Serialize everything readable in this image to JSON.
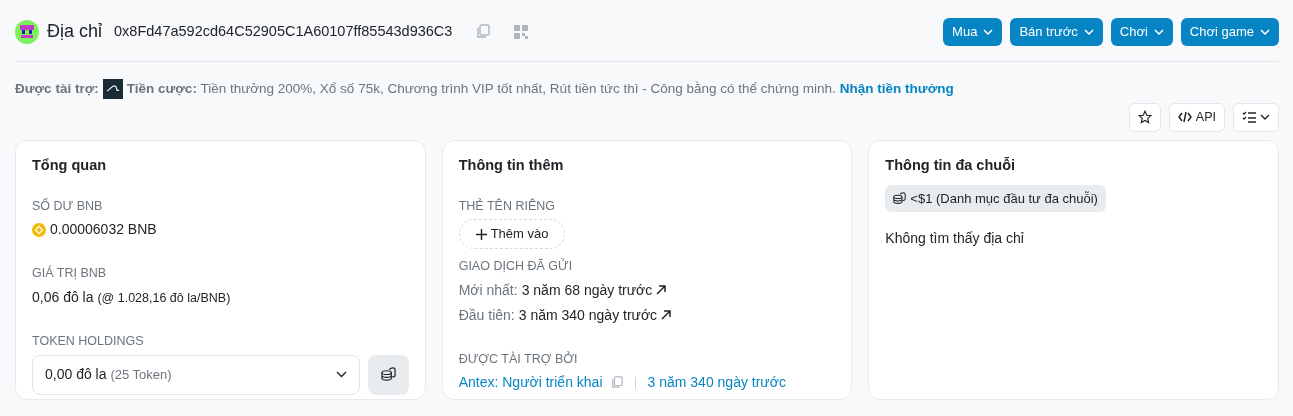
{
  "header": {
    "title": "Địa chỉ",
    "address": "0x8Fd47a592cd64C52905C1A60107ff85543d936C3",
    "menus": [
      {
        "label": "Mua"
      },
      {
        "label": "Bán trước"
      },
      {
        "label": "Chơi"
      },
      {
        "label": "Chơi game"
      }
    ]
  },
  "sponsor": {
    "label": "Được tài trợ:",
    "name": "Tiền cược:",
    "text": "Tiền thưởng 200%, Xổ số 75k, Chương trình VIP tốt nhất, Rút tiền tức thì - Công bằng có thể chứng minh.",
    "link": "Nhận tiền thưởng"
  },
  "toolbar": {
    "api": "API"
  },
  "overview": {
    "title": "Tổng quan",
    "balance_label": "SỐ DƯ BNB",
    "balance": "0.00006032 BNB",
    "value_label": "GIÁ TRỊ BNB",
    "value": "0,06 đô la",
    "rate": "(@ 1.028,16 đô la/BNB)",
    "holdings_label": "TOKEN HOLDINGS",
    "holdings_value": "0,00 đô la",
    "holdings_count": "(25 Token)"
  },
  "more_info": {
    "title": "Thông tin thêm",
    "tag_label": "THẺ TÊN RIÊNG",
    "add_button": "Thêm vào",
    "tx_label": "GIAO DỊCH ĐÃ GỬI",
    "tx": [
      {
        "label": "Mới nhất:",
        "value": "3 năm 68 ngày trước"
      },
      {
        "label": "Đầu tiên:",
        "value": "3 năm 340 ngày trước"
      }
    ],
    "funded_label": "ĐƯỢC TÀI TRỢ BỞI",
    "funder": "Antex: Người triển khai",
    "funded_time": "3 năm 340 ngày trước"
  },
  "multichain": {
    "title": "Thông tin đa chuỗi",
    "portfolio": "<$1 (Danh mục đầu tư đa chuỗi)",
    "message": "Không tìm thấy địa chỉ"
  }
}
